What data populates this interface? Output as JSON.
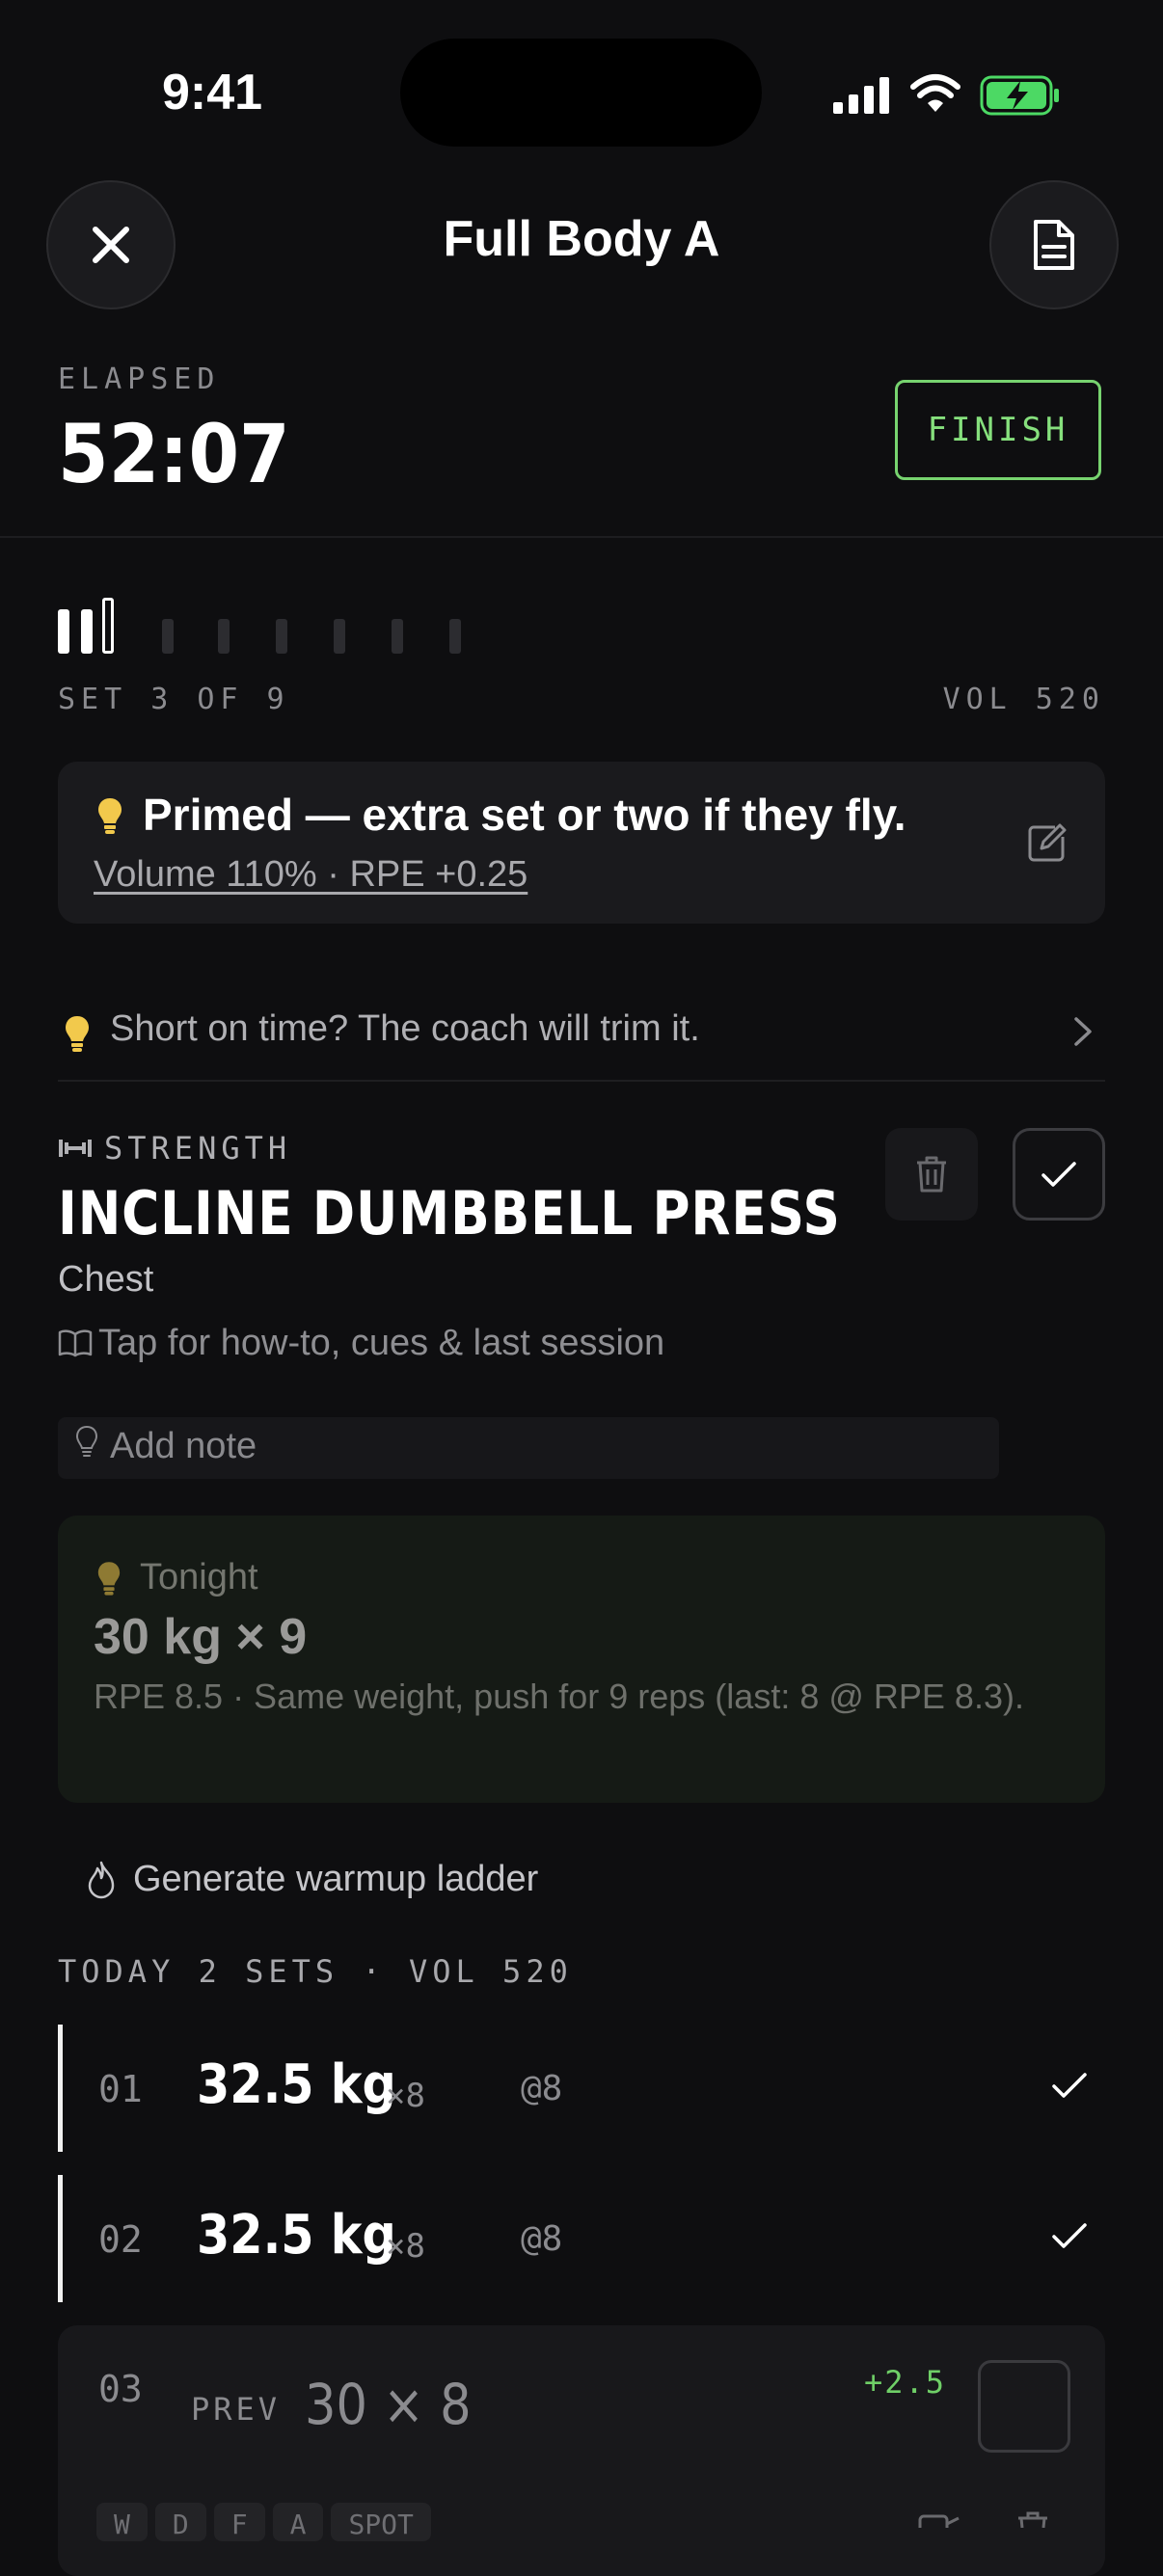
{
  "status_bar": {
    "time": "9:41"
  },
  "header": {
    "title": "Full Body A"
  },
  "elapsed": {
    "label": "ELAPSED",
    "value": "52:07",
    "finish_label": "FINISH"
  },
  "progress": {
    "set_label": "SET 3 OF 9",
    "volume_label": "VOL 520",
    "current_set": 3,
    "total_sets": 9
  },
  "primed": {
    "title": "Primed — extra set or two if they fly.",
    "subtitle": "Volume 110% · RPE +0.25"
  },
  "short_on_time": {
    "text": "Short on time? The coach will trim it."
  },
  "exercise": {
    "category": "STRENGTH",
    "name": "INCLINE DUMBBELL PRESS",
    "muscle": "Chest",
    "howto": "Tap for how-to, cues & last session",
    "note_placeholder": "Add note"
  },
  "tonight": {
    "label": "Tonight",
    "value": "30 kg × 9",
    "description": "RPE 8.5 · Same weight, push for 9 reps (last: 8 @ RPE 8.3)."
  },
  "warmup": {
    "label": "Generate warmup ladder"
  },
  "today": {
    "label": "TODAY 2 SETS · VOL 520"
  },
  "sets": [
    {
      "index": "01",
      "weight": "32.5 kg",
      "reps": "×8",
      "rpe": "@8"
    },
    {
      "index": "02",
      "weight": "32.5 kg",
      "reps": "×8",
      "rpe": "@8"
    }
  ],
  "active_set": {
    "index": "03",
    "prev_label": "PREV",
    "prev_value": "30 × 8",
    "delta": "+2.5"
  },
  "chips": [
    "W",
    "D",
    "F",
    "A",
    "SPOT"
  ],
  "colors": {
    "accent": "#86e07d",
    "bulb": "#f2c94c",
    "battery": "#4cd964"
  }
}
